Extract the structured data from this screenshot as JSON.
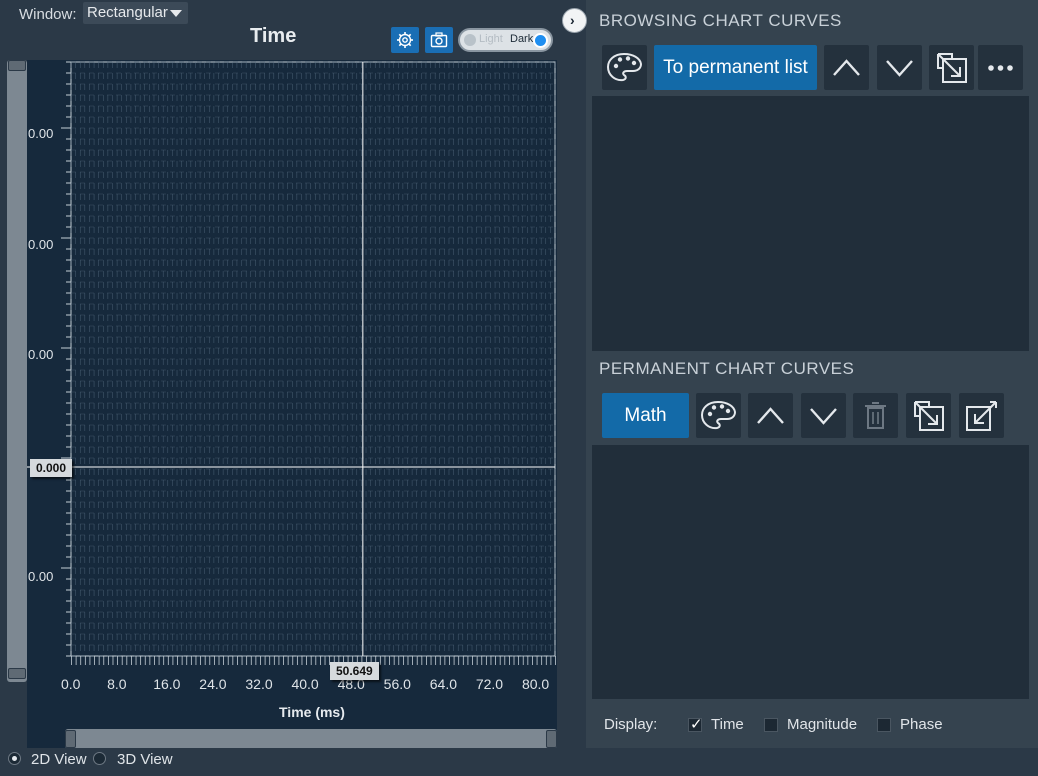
{
  "window": {
    "label": "Window:",
    "selected": "Rectangular"
  },
  "chart": {
    "title": "Time",
    "theme_light": "Light",
    "theme_dark": "Dark",
    "y_tick_labels": [
      "0.00",
      "0.00",
      "0.00",
      "0.00"
    ],
    "x_tick_labels": [
      "0.0",
      "8.0",
      "16.0",
      "24.0",
      "32.0",
      "40.0",
      "48.0",
      "56.0",
      "64.0",
      "72.0",
      "80.0"
    ],
    "x_axis_label": "Time (ms)",
    "cursor_y": "0.000",
    "cursor_x": "50.649",
    "colors": {
      "plot_bg": "#16293c",
      "grid": "#5d7489",
      "cursor": "#ffffff"
    }
  },
  "chart_data": {
    "type": "line",
    "title": "Time",
    "xlabel": "Time (ms)",
    "ylabel": "",
    "xlim": [
      0,
      84
    ],
    "x_ticks": [
      0,
      8,
      16,
      24,
      32,
      40,
      48,
      56,
      64,
      72,
      80
    ],
    "y_tick_labels": [
      "0.00",
      "0.00",
      "0.00",
      "0.00"
    ],
    "grid": true,
    "series": [],
    "cursor": {
      "x": 50.649,
      "y": 0.0
    }
  },
  "views": {
    "view_2d": "2D View",
    "view_3d": "3D View",
    "selected": "2D View"
  },
  "browsing": {
    "title": "BROWSING CHART CURVES",
    "palette_icon": "palette-icon",
    "to_permanent_label": "To permanent list",
    "more_icon": "more-icon"
  },
  "permanent": {
    "title": "PERMANENT CHART CURVES",
    "math_label": "Math"
  },
  "display": {
    "label": "Display:",
    "options": [
      {
        "label": "Time",
        "checked": true
      },
      {
        "label": "Magnitude",
        "checked": false
      },
      {
        "label": "Phase",
        "checked": false
      }
    ]
  }
}
